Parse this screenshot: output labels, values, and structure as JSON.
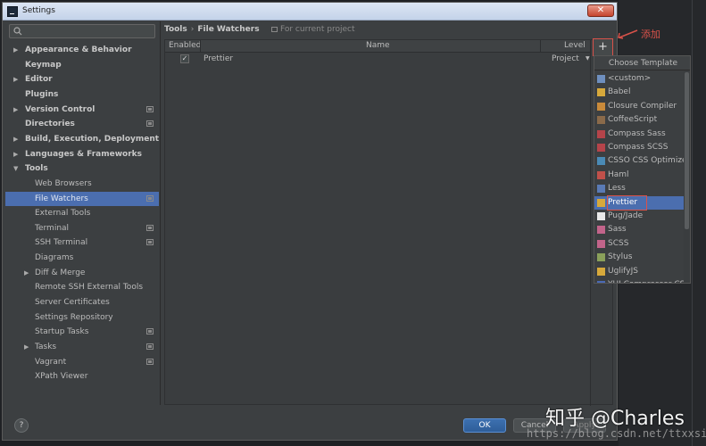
{
  "window": {
    "title": "Settings",
    "close": "✕"
  },
  "search": {
    "placeholder": "",
    "icon": "search-icon"
  },
  "sidebar": {
    "items": [
      {
        "label": "Appearance & Behavior",
        "level": 0,
        "arrow": "▶",
        "bold": true,
        "proj": false
      },
      {
        "label": "Keymap",
        "level": 0,
        "arrow": "",
        "bold": true,
        "proj": false
      },
      {
        "label": "Editor",
        "level": 0,
        "arrow": "▶",
        "bold": true,
        "proj": false
      },
      {
        "label": "Plugins",
        "level": 0,
        "arrow": "",
        "bold": true,
        "proj": false
      },
      {
        "label": "Version Control",
        "level": 0,
        "arrow": "▶",
        "bold": true,
        "proj": true
      },
      {
        "label": "Directories",
        "level": 0,
        "arrow": "",
        "bold": true,
        "proj": true
      },
      {
        "label": "Build, Execution, Deployment",
        "level": 0,
        "arrow": "▶",
        "bold": true,
        "proj": false
      },
      {
        "label": "Languages & Frameworks",
        "level": 0,
        "arrow": "▶",
        "bold": true,
        "proj": false
      },
      {
        "label": "Tools",
        "level": 0,
        "arrow": "▼",
        "bold": true,
        "proj": false
      },
      {
        "label": "Web Browsers",
        "level": 1,
        "arrow": "",
        "bold": false,
        "proj": false
      },
      {
        "label": "File Watchers",
        "level": 1,
        "arrow": "",
        "bold": false,
        "proj": true,
        "selected": true
      },
      {
        "label": "External Tools",
        "level": 1,
        "arrow": "",
        "bold": false,
        "proj": false
      },
      {
        "label": "Terminal",
        "level": 1,
        "arrow": "",
        "bold": false,
        "proj": true
      },
      {
        "label": "SSH Terminal",
        "level": 1,
        "arrow": "",
        "bold": false,
        "proj": true
      },
      {
        "label": "Diagrams",
        "level": 1,
        "arrow": "",
        "bold": false,
        "proj": false
      },
      {
        "label": "Diff & Merge",
        "level": 1,
        "arrow": "▶",
        "bold": false,
        "proj": false
      },
      {
        "label": "Remote SSH External Tools",
        "level": 1,
        "arrow": "",
        "bold": false,
        "proj": false
      },
      {
        "label": "Server Certificates",
        "level": 1,
        "arrow": "",
        "bold": false,
        "proj": false
      },
      {
        "label": "Settings Repository",
        "level": 1,
        "arrow": "",
        "bold": false,
        "proj": false
      },
      {
        "label": "Startup Tasks",
        "level": 1,
        "arrow": "",
        "bold": false,
        "proj": true
      },
      {
        "label": "Tasks",
        "level": 1,
        "arrow": "▶",
        "bold": false,
        "proj": true
      },
      {
        "label": "Vagrant",
        "level": 1,
        "arrow": "",
        "bold": false,
        "proj": true
      },
      {
        "label": "XPath Viewer",
        "level": 1,
        "arrow": "",
        "bold": false,
        "proj": false
      }
    ]
  },
  "breadcrumb": {
    "parent": "Tools",
    "separator": "›",
    "current": "File Watchers"
  },
  "scope": {
    "label": "For current project"
  },
  "table": {
    "headers": {
      "enabled": "Enabled",
      "name": "Name",
      "level": "Level"
    },
    "rows": [
      {
        "enabled": "✓",
        "name": "Prettier",
        "level": "Project",
        "level_arrow": "▼"
      }
    ]
  },
  "add_button": {
    "label": "+"
  },
  "annotation": {
    "text": "添加"
  },
  "popup": {
    "title": "Choose Template",
    "items": [
      {
        "label": "<custom>",
        "color": "#6e8fbf"
      },
      {
        "label": "Babel",
        "color": "#d7a93b"
      },
      {
        "label": "Closure Compiler",
        "color": "#c98a3a"
      },
      {
        "label": "CoffeeScript",
        "color": "#8a6a4a"
      },
      {
        "label": "Compass Sass",
        "color": "#b5444a"
      },
      {
        "label": "Compass SCSS",
        "color": "#b5444a"
      },
      {
        "label": "CSSO CSS Optimizer",
        "color": "#4a8ab5"
      },
      {
        "label": "Haml",
        "color": "#c0504a"
      },
      {
        "label": "Less",
        "color": "#5a7ab5"
      },
      {
        "label": "Prettier",
        "color": "#d7a93b",
        "selected": true
      },
      {
        "label": "Pug/Jade",
        "color": "#e8e8e8"
      },
      {
        "label": "Sass",
        "color": "#c2648a"
      },
      {
        "label": "SCSS",
        "color": "#c2648a"
      },
      {
        "label": "Stylus",
        "color": "#8aa05a"
      },
      {
        "label": "UglifyJS",
        "color": "#d7a93b"
      },
      {
        "label": "YUI Compressor CSS",
        "color": "#4a6ab5"
      }
    ]
  },
  "buttons": {
    "ok": "OK",
    "cancel": "Cancel",
    "apply": "Apply",
    "help": "?"
  },
  "watermark": {
    "brand": "知乎 @Charles",
    "url": "https://blog.csdn.net/ttxxsir"
  },
  "colors": {
    "selection": "#4b6eaf",
    "highlight_red": "#d9524a",
    "panel": "#3c3f41"
  }
}
